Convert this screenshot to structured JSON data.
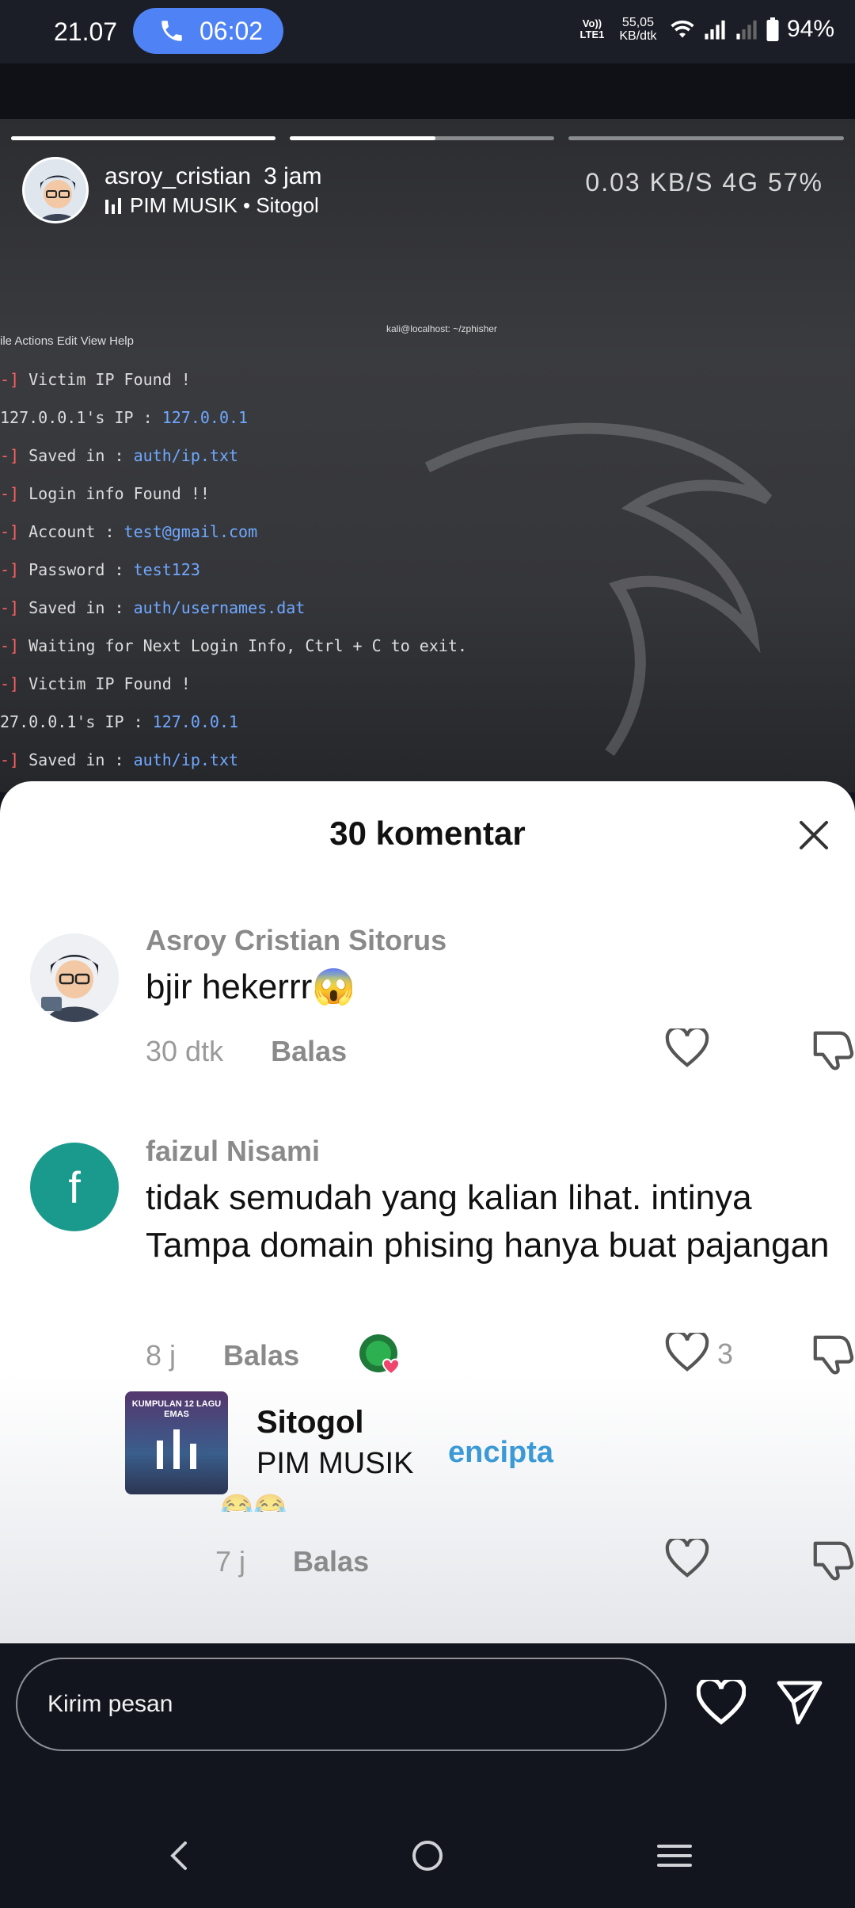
{
  "status_bar": {
    "time": "21.07",
    "call_timer": "06:02",
    "volte": "Vo)) LTE1",
    "speed": "55,05 KB/dtk",
    "battery": "94%"
  },
  "story": {
    "username": "asroy_cristian",
    "time_ago": "3 jam",
    "music": "PIM MUSIK • Sitogol",
    "phone_status": "0.03 KB/S  4G  57%",
    "terminal": {
      "menu": "ile  Actions  Edit  View  Help",
      "title": "kali@localhost: ~/zphisher",
      "lines": [
        {
          "prefix": "-] ",
          "key": "Victim IP Found !",
          "value": ""
        },
        {
          "prefix": "",
          "key": "127.0.0.1's IP : ",
          "value": "127.0.0.1"
        },
        {
          "prefix": "-] ",
          "key": "Saved in : ",
          "value": "auth/ip.txt"
        },
        {
          "prefix": "-] ",
          "key": "Login info Found !!",
          "value": ""
        },
        {
          "prefix": "-] ",
          "key": "Account : ",
          "value": "test@gmail.com"
        },
        {
          "prefix": "-] ",
          "key": "Password : ",
          "value": "test123"
        },
        {
          "prefix": "-] ",
          "key": "Saved in : ",
          "value": "auth/usernames.dat"
        },
        {
          "prefix": "-] ",
          "key": "Waiting for Next Login Info, Ctrl + C to exit.",
          "value": ""
        },
        {
          "prefix": "-] ",
          "key": "Victim IP Found !",
          "value": ""
        },
        {
          "prefix": "",
          "key": "27.0.0.1's IP : ",
          "value": "127.0.0.1"
        },
        {
          "prefix": "-] ",
          "key": "Saved in : ",
          "value": "auth/ip.txt"
        }
      ]
    }
  },
  "comments_sheet": {
    "title": "30 komentar",
    "comments": [
      {
        "name": "Asroy Cristian Sitorus",
        "text": "bjir hekerrr😱",
        "time": "30 dtk",
        "reply": "Balas",
        "likes": ""
      },
      {
        "name": "faizul Nisami",
        "avatar_letter": "f",
        "text": "tidak semudah yang kalian lihat. intinya Tampa domain phising hanya buat pajangan",
        "time": "8 j",
        "reply": "Balas",
        "likes": "3"
      },
      {
        "name": "",
        "text": "😂😂",
        "time": "7 j",
        "reply": "Balas",
        "likes": ""
      }
    ],
    "music_chip": {
      "title": "Sitogol",
      "artist": "PIM MUSIK",
      "album_text": "KUMPULAN 12 LAGU EMAS",
      "overlap_text": "encipta"
    }
  },
  "input_bar": {
    "placeholder": "Kirim pesan"
  },
  "colors": {
    "call_pill": "#4e82f5",
    "faizul_avatar": "#1a9a8c",
    "link_blue": "#3b9ad6"
  }
}
